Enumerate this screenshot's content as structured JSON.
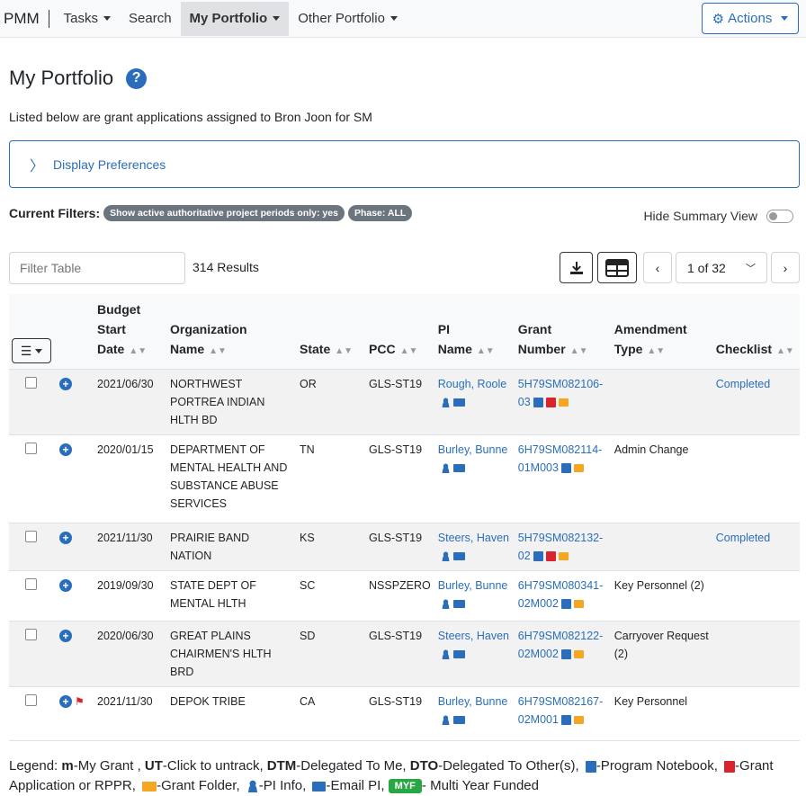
{
  "nav": {
    "brand": "PMM",
    "tasks": "Tasks",
    "search": "Search",
    "my_portfolio": "My Portfolio",
    "other_portfolio": "Other Portfolio",
    "actions": "Actions"
  },
  "page": {
    "title": "My Portfolio",
    "help": "?",
    "subtitle": "Listed below are grant applications assigned to Bron Joon for SM",
    "display_preferences": "Display Preferences"
  },
  "filters": {
    "label": "Current Filters:",
    "badge1": "Show active authoritative project periods only: yes",
    "badge2": "Phase: ALL",
    "hide_summary": "Hide Summary View"
  },
  "toolbar": {
    "filter_placeholder": "Filter Table",
    "results": "314 Results",
    "page_select": "1 of 32"
  },
  "table": {
    "headers": {
      "budget": [
        "Budget",
        "Start",
        "Date"
      ],
      "org": [
        "Organization",
        "Name"
      ],
      "state": "State",
      "pcc": "PCC",
      "pi": [
        "PI",
        "Name"
      ],
      "grant": [
        "Grant",
        "Number"
      ],
      "amend": [
        "Amendment",
        "Type"
      ],
      "checklist": "Checklist"
    },
    "rows": [
      {
        "date": "2021/06/30",
        "org": "NORTHWEST PORTREA INDIAN HLTH BD",
        "state": "OR",
        "pcc": "GLS-ST19",
        "pi": "Rough, Roole",
        "grant": "5H79SM082106-03",
        "amend": "",
        "checklist": "Completed"
      },
      {
        "date": "2020/01/15",
        "org": "DEPARTMENT OF MENTAL HEALTH AND SUBSTANCE ABUSE SERVICES",
        "state": "TN",
        "pcc": "GLS-ST19",
        "pi": "Burley, Bunne",
        "grant": "6H79SM082114-01M003",
        "amend": "Admin Change",
        "checklist": ""
      },
      {
        "date": "2021/11/30",
        "org": "PRAIRIE BAND NATION",
        "state": "KS",
        "pcc": "GLS-ST19",
        "pi": "Steers, Haven",
        "grant": "5H79SM082132-02",
        "amend": "",
        "checklist": "Completed"
      },
      {
        "date": "2019/09/30",
        "org": "STATE DEPT OF MENTAL HLTH",
        "state": "SC",
        "pcc": "NSSPZERO",
        "pi": "Burley, Bunne",
        "grant": "6H79SM080341-02M002",
        "amend": "Key Personnel (2)",
        "checklist": ""
      },
      {
        "date": "2020/06/30",
        "org": "GREAT PLAINS CHAIRMEN'S HLTH BRD",
        "state": "SD",
        "pcc": "GLS-ST19",
        "pi": "Steers, Haven",
        "grant": "6H79SM082122-02M002",
        "amend": "Carryover Request (2)",
        "checklist": ""
      },
      {
        "date": "2021/11/30",
        "org": "DEPOK TRIBE",
        "state": "CA",
        "pcc": "GLS-ST19",
        "pi": "Burley, Bunne",
        "grant": "6H79SM082167-02M001",
        "amend": "Key Personnel",
        "checklist": ""
      }
    ]
  },
  "legend": {
    "prefix": "Legend: ",
    "m": "m",
    "m_text": "-My Grant , ",
    "ut": "UT",
    "ut_text": "-Click to untrack, ",
    "dtm": "DTM",
    "dtm_text": "-Delegated To Me, ",
    "dto": "DTO",
    "dto_text": "-Delegated To Other(s), ",
    "notebook": "-Program Notebook, ",
    "pdf": "-Grant Application or RPPR, ",
    "folder": "-Grant Folder, ",
    "pi": "-PI Info, ",
    "email": "-Email PI, ",
    "myf": "MYF",
    "myf_text": "- Multi Year Funded"
  }
}
